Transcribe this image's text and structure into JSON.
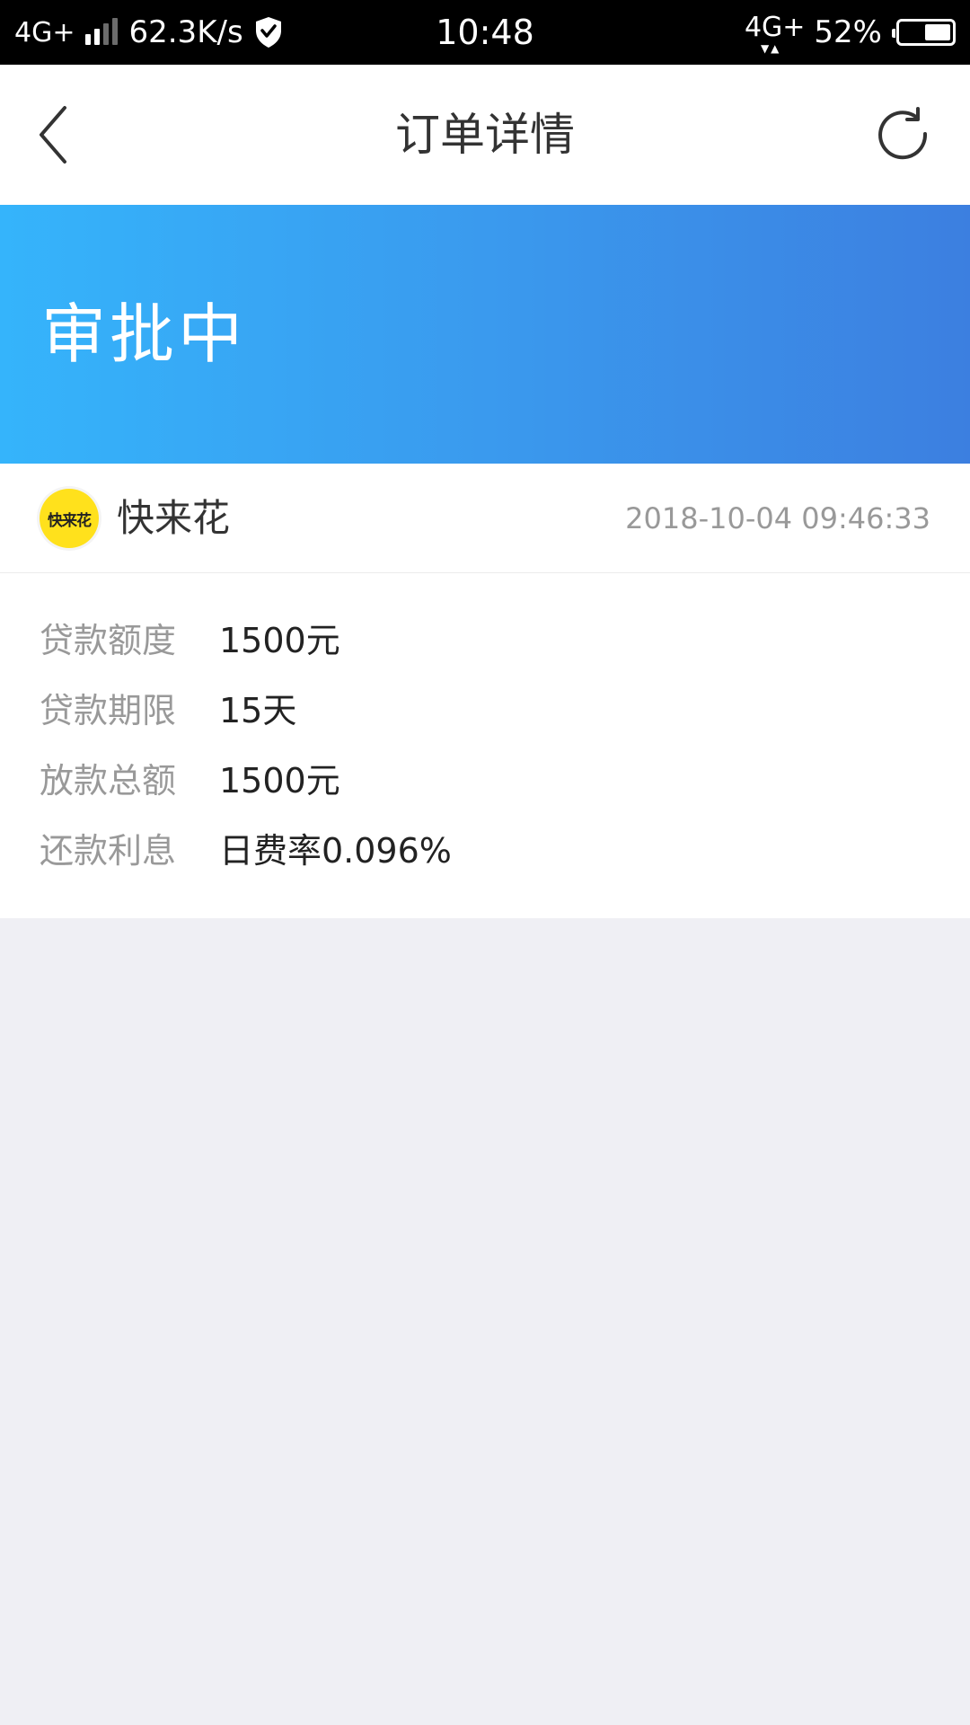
{
  "status_bar": {
    "network": "4G+",
    "speed": "62.3K/s",
    "time": "10:48",
    "network_right": "4G+",
    "battery_percent_text": "52%",
    "battery_level": 0.52
  },
  "nav": {
    "title": "订单详情",
    "back_icon": "chevron-left-icon",
    "refresh_icon": "refresh-icon"
  },
  "order": {
    "status": "审批中",
    "merchant": {
      "name": "快来花",
      "logo_text": "快来花",
      "logo_color": "#ffe11c"
    },
    "time": "2018-10-04 09:46:33",
    "details": [
      {
        "label": "贷款额度",
        "value": "1500元"
      },
      {
        "label": "贷款期限",
        "value": "15天"
      },
      {
        "label": "放款总额",
        "value": "1500元"
      },
      {
        "label": "还款利息",
        "value": "日费率0.096%"
      }
    ]
  },
  "colors": {
    "banner_start": "#35b4fb",
    "banner_end": "#3c7fe0",
    "page_bg": "#efeff4"
  }
}
